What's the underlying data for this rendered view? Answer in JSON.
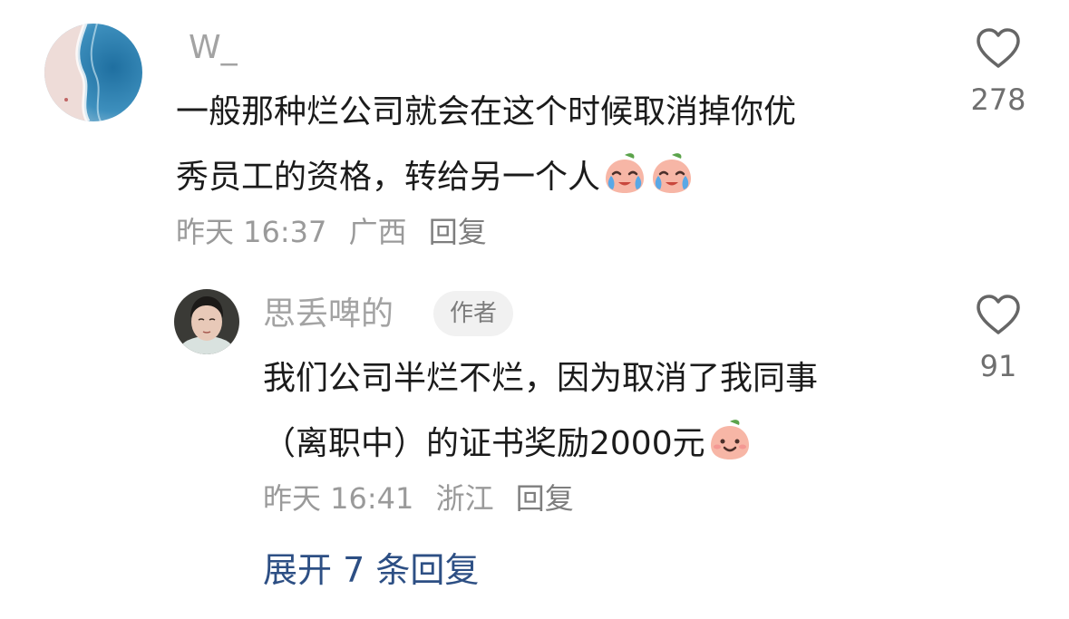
{
  "main_comment": {
    "username": "W_",
    "text_lines": [
      "一般那种烂公司就会在这个时候取消掉你优",
      "秀员工的资格，转给另一个人"
    ],
    "emojis": [
      "crying-peach-emoji",
      "crying-peach-emoji"
    ],
    "time": "昨天 16:37",
    "location": "广西",
    "reply_label": "回复",
    "like_count": "278"
  },
  "reply_comment": {
    "username": "思丢啤的",
    "author_badge": "作者",
    "text_lines": [
      "我们公司半烂不烂，因为取消了我同事",
      "（离职中）的证书奖励2000元"
    ],
    "emojis": [
      "smiling-peach-emoji"
    ],
    "time": "昨天 16:41",
    "location": "浙江",
    "reply_label": "回复",
    "like_count": "91"
  },
  "expand_replies": "展开 7 条回复",
  "colors": {
    "text": "#1b1b1b",
    "meta": "#9a9a9a",
    "link": "#2d4f84",
    "badge_bg": "#f1f1f1"
  }
}
